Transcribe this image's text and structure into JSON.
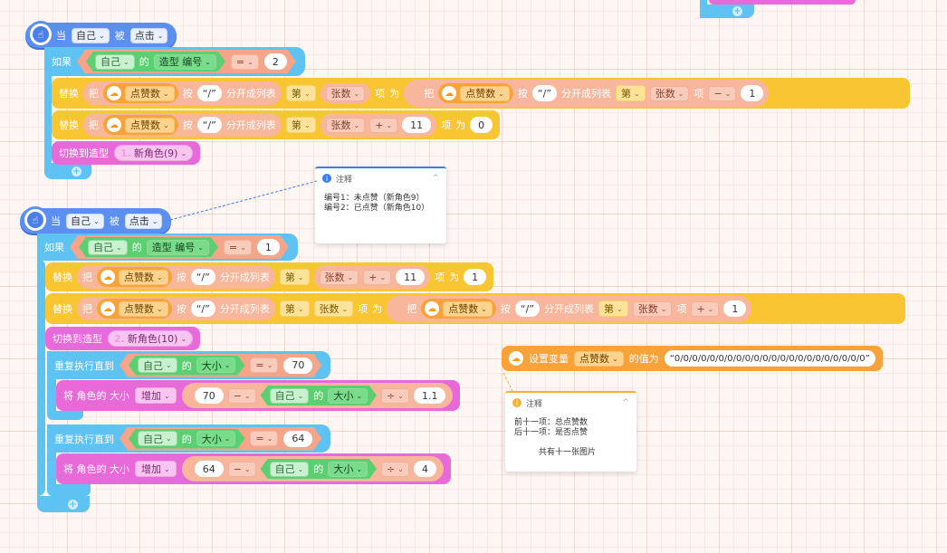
{
  "top_partial": {
    "add_symbol": "+"
  },
  "script1": {
    "event": {
      "hand_icon": "pointer-hand-icon",
      "when": "当",
      "target": "自己",
      "verb": "被",
      "action": "点击"
    },
    "if": {
      "label": "如果",
      "obj": "自己",
      "of": "的",
      "prop": "造型 编号",
      "op": "=",
      "value": "2"
    },
    "replace1": {
      "label": "替换",
      "ba": "把",
      "var": "点赞数",
      "an": "按",
      "sep": "“/”",
      "split": "分开成列表",
      "di": "第",
      "idx_var": "张数",
      "xiang": "项",
      "wei": "为",
      "inner": {
        "ba": "把",
        "var": "点赞数",
        "an": "按",
        "sep": "“/”",
        "split": "分开成列表",
        "di": "第",
        "idx_var": "张数",
        "xiang": "项",
        "op": "−",
        "num": "1"
      }
    },
    "replace2": {
      "label": "替换",
      "ba": "把",
      "var": "点赞数",
      "an": "按",
      "sep": "“/”",
      "split": "分开成列表",
      "di": "第",
      "idx_var": "张数",
      "op": "+",
      "num": "11",
      "xiang": "项",
      "wei": "为",
      "value": "0"
    },
    "costume": {
      "label": "切换到造型",
      "num": "1.",
      "name": "新角色(9)"
    },
    "add": "+"
  },
  "note1": {
    "title": "注释",
    "lines": [
      "编号1：未点赞（新角色9）",
      "编号2：已点赞（新角色10）"
    ]
  },
  "script2": {
    "event": {
      "hand_icon": "pointer-hand-icon",
      "when": "当",
      "target": "自己",
      "verb": "被",
      "action": "点击"
    },
    "if": {
      "label": "如果",
      "obj": "自己",
      "of": "的",
      "prop": "造型 编号",
      "op": "=",
      "value": "1"
    },
    "replace1": {
      "label": "替换",
      "ba": "把",
      "var": "点赞数",
      "an": "按",
      "sep": "“/”",
      "split": "分开成列表",
      "di": "第",
      "idx_var": "张数",
      "op": "+",
      "num": "11",
      "xiang": "项",
      "wei": "为",
      "value": "1"
    },
    "replace2": {
      "label": "替换",
      "ba": "把",
      "var": "点赞数",
      "an": "按",
      "sep": "“/”",
      "split": "分开成列表",
      "di": "第",
      "idx_var": "张数",
      "xiang": "项",
      "wei": "为",
      "inner": {
        "ba": "把",
        "var": "点赞数",
        "an": "按",
        "sep": "“/”",
        "split": "分开成列表",
        "di": "第",
        "idx_var": "张数",
        "xiang": "项",
        "op": "+",
        "num": "1"
      }
    },
    "costume": {
      "label": "切换到造型",
      "num": "2.",
      "name": "新角色(10)"
    },
    "repeat1": {
      "label": "重复执行直到",
      "obj": "自己",
      "of": "的",
      "prop": "大小",
      "op": "=",
      "value": "70",
      "body": {
        "label": "将 角色的 大小",
        "mode": "增加",
        "a": "70",
        "minus": "−",
        "obj": "自己",
        "of": "的",
        "prop": "大小",
        "div": "÷",
        "b": "1.1"
      }
    },
    "repeat2": {
      "label": "重复执行直到",
      "obj": "自己",
      "of": "的",
      "prop": "大小",
      "op": "=",
      "value": "64",
      "body": {
        "label": "将 角色的 大小",
        "mode": "增加",
        "a": "64",
        "minus": "−",
        "obj": "自己",
        "of": "的",
        "prop": "大小",
        "div": "÷",
        "b": "4"
      }
    },
    "add": "+"
  },
  "set_var": {
    "label": "设置变量",
    "var": "点赞数",
    "de": "的值为",
    "value": "“0/0/0/0/0/0/0/0/0/0/0/0/0/0/0/0/0/0/0/0/0/0”"
  },
  "note2": {
    "title": "注释",
    "lines": [
      "前十一项：总点赞数",
      "后十一项：是否点赞",
      "",
      "共有十一张图片"
    ]
  },
  "caret": "⌄",
  "collapse": "^"
}
